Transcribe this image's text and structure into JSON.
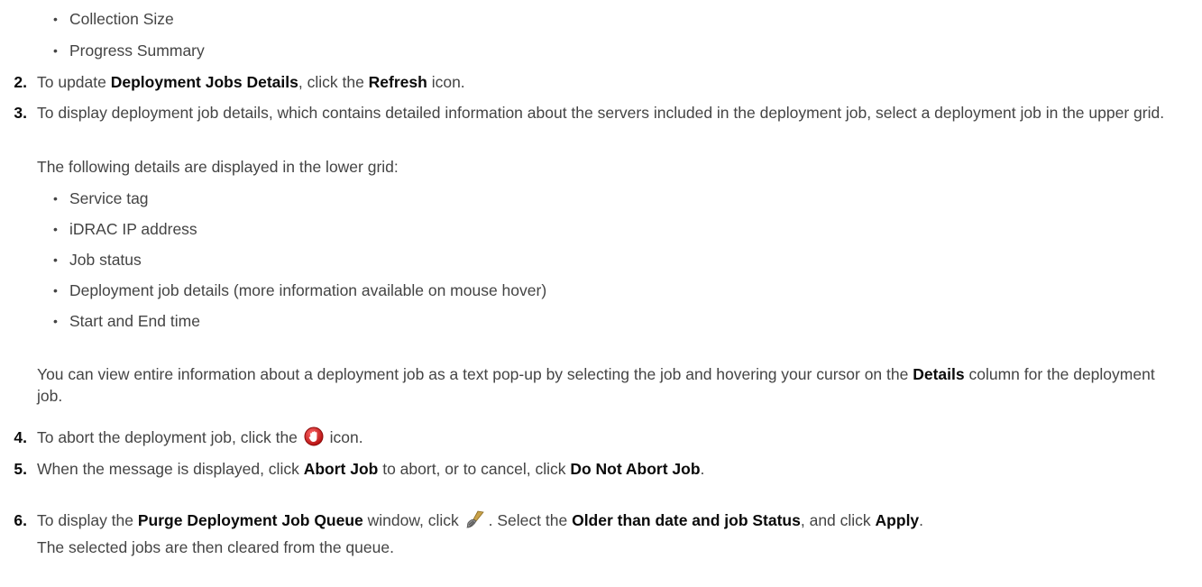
{
  "bullets_top": [
    "Collection Size",
    "Progress Summary"
  ],
  "step2": {
    "num": "2.",
    "pre": "To update ",
    "b1": "Deployment Jobs Details",
    "mid": ", click the ",
    "b2": "Refresh",
    "post": " icon."
  },
  "step3": {
    "num": "3.",
    "text": "To display deployment job details, which contains detailed information about the servers included in the deployment job, select a deployment job in the upper grid.",
    "intro": "The following details are displayed in the lower grid:",
    "bullets": [
      "Service tag",
      "iDRAC IP address",
      "Job status",
      "Deployment job details (more information available on mouse hover)",
      "Start and End time"
    ],
    "note_pre": "You can view entire information about a deployment job as a text pop-up by selecting the job and hovering your cursor on the ",
    "note_bold": "Details",
    "note_post": " column for the deployment job."
  },
  "step4": {
    "num": "4.",
    "pre": "To abort the deployment job, click the ",
    "post": " icon.",
    "icon": "abort-hand-icon",
    "icon_color": "#d42020"
  },
  "step5": {
    "num": "5.",
    "pre": "When the message is displayed, click ",
    "b1": "Abort Job",
    "mid": " to abort, or to cancel, click ",
    "b2": "Do Not Abort Job",
    "post": "."
  },
  "step6": {
    "num": "6.",
    "pre": "To display the ",
    "b1": "Purge Deployment Job Queue",
    "mid1": " window, click ",
    "mid2": ". Select the ",
    "b2": "Older than date and job Status",
    "mid3": ", and click ",
    "b3": "Apply",
    "post": ".",
    "icon": "purge-broom-icon",
    "line2": "The selected jobs are then cleared from the queue."
  }
}
